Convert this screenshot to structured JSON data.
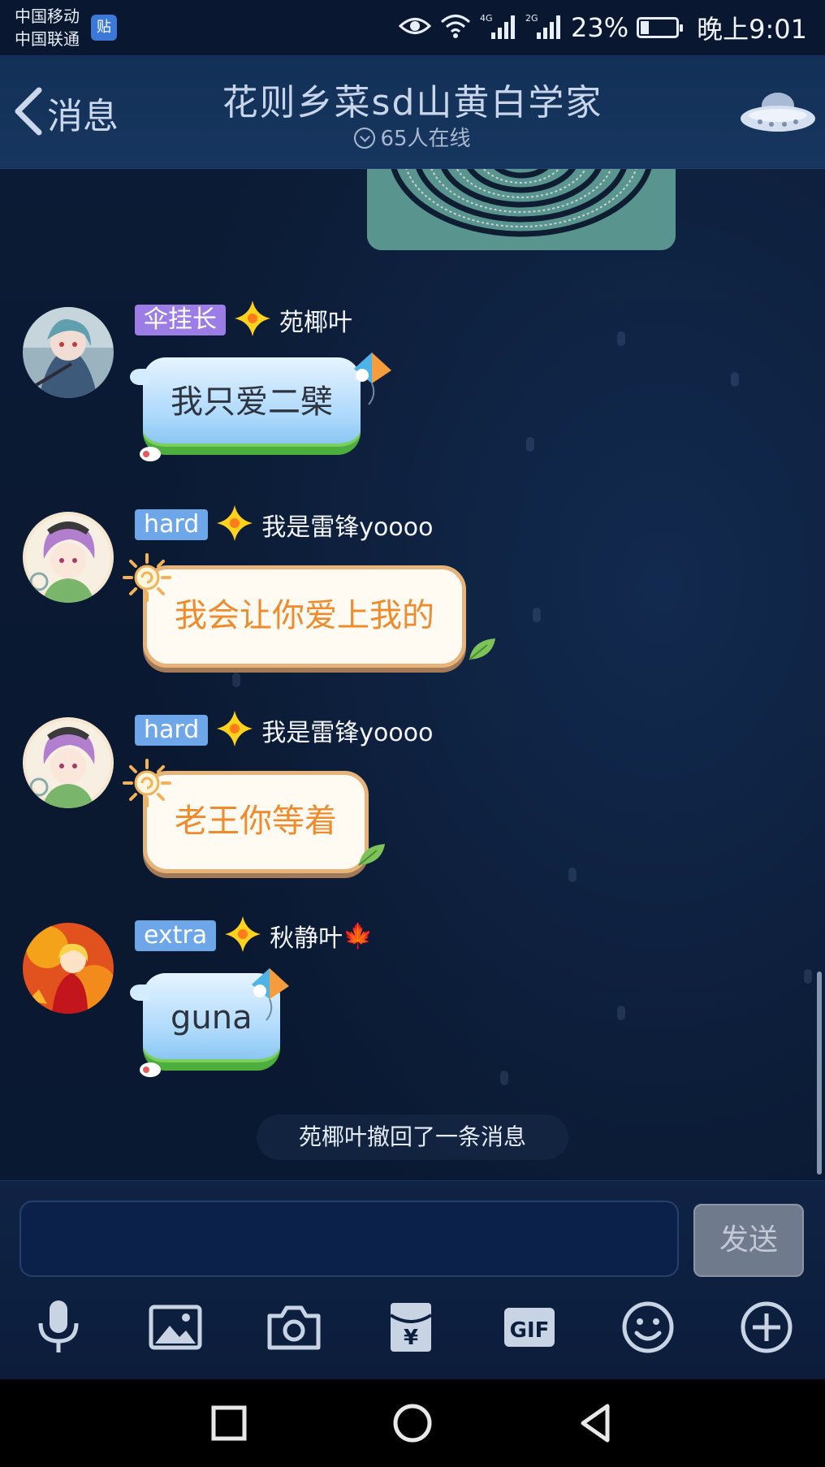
{
  "status_bar": {
    "carrier_1": "中国移动",
    "carrier_2": "中国联通",
    "app_badge": "贴",
    "net_1": "4G",
    "net_2": "2G",
    "battery_percent": "23%",
    "battery_level": 0.23,
    "time": "晚上9:01",
    "icons": [
      "eye-icon",
      "wifi-icon",
      "signal-4g-icon",
      "signal-2g-icon",
      "battery-icon"
    ]
  },
  "header": {
    "back_label": "消息",
    "title": "花则乡菜sd山黄白学家",
    "online": "65人在线",
    "icons": [
      "back-chevron-icon",
      "online-chevron-icon",
      "ufo-icon"
    ]
  },
  "messages": [
    {
      "badge": "伞挂长",
      "badge_color": "#9c7de6",
      "nickname": "苑椰叶",
      "text": "我只爱二檗",
      "bubble": "blue-kite"
    },
    {
      "badge": "hard",
      "badge_color": "#6ea6ea",
      "nickname": "我是雷锋yoooo",
      "text": "我会让你爱上我的",
      "bubble": "orange-sun"
    },
    {
      "badge": "hard",
      "badge_color": "#6ea6ea",
      "nickname": "我是雷锋yoooo",
      "text": "老王你等着",
      "bubble": "orange-sun"
    },
    {
      "badge": "extra",
      "badge_color": "#6ea6ea",
      "nickname": "秋静叶",
      "nickname_emoji": "🍁",
      "text": "guna",
      "bubble": "blue-kite"
    }
  ],
  "recall_notice": "苑椰叶撤回了一条消息",
  "input": {
    "placeholder": "",
    "value": "",
    "send_label": "发送"
  },
  "toolbar": [
    "microphone-icon",
    "image-icon",
    "camera-icon",
    "red-packet-icon",
    "gif-icon",
    "emoji-icon",
    "plus-icon"
  ],
  "toolbar_gif_label": "GIF",
  "toolbar_yen_label": "¥",
  "nav": [
    "recent-apps-icon",
    "home-icon",
    "back-icon"
  ]
}
